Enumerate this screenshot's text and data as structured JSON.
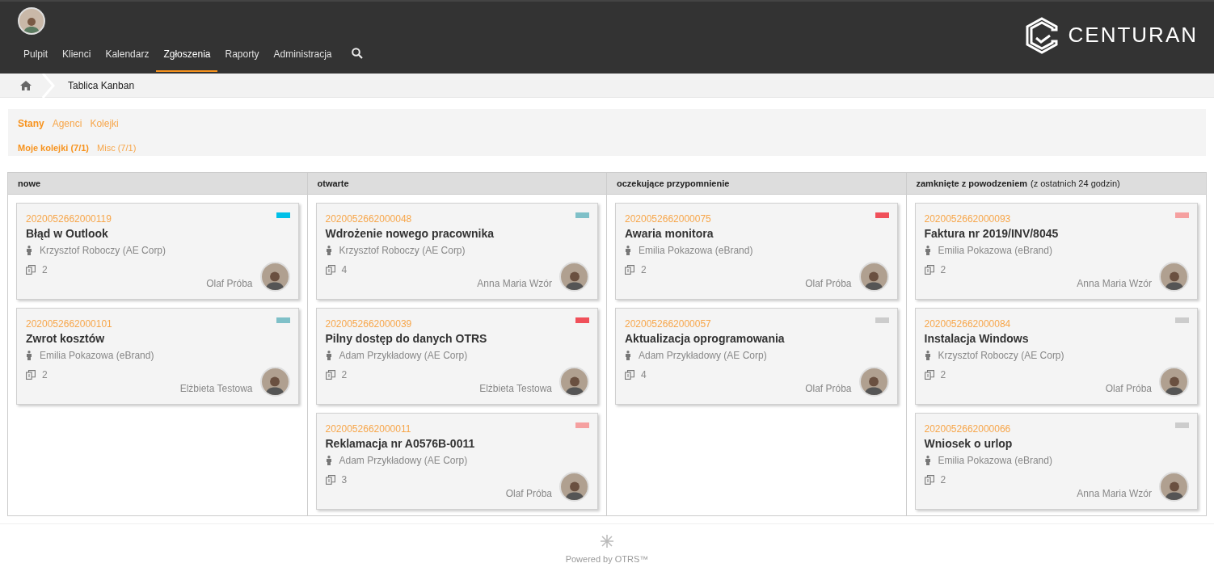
{
  "nav": [
    {
      "label": "Pulpit",
      "selected": false
    },
    {
      "label": "Klienci",
      "selected": false
    },
    {
      "label": "Kalendarz",
      "selected": false
    },
    {
      "label": "Zgłoszenia",
      "selected": true
    },
    {
      "label": "Raporty",
      "selected": false
    },
    {
      "label": "Administracja",
      "selected": false
    }
  ],
  "logo": {
    "text": "CENTURAN"
  },
  "breadcrumb": [
    "Tablica Kanban"
  ],
  "view_filters": [
    {
      "label": "Stany",
      "selected": true
    },
    {
      "label": "Agenci",
      "selected": false
    },
    {
      "label": "Kolejki",
      "selected": false
    }
  ],
  "queue_filters": [
    {
      "label": "Moje kolejki (7/1)",
      "selected": true
    },
    {
      "label": "Misc (7/1)",
      "selected": false
    }
  ],
  "columns": [
    {
      "title": "nowe",
      "cards": [
        {
          "number": "2020052662000119",
          "title": "Błąd w Outlook",
          "customer": "Krzysztof Roboczy (AE Corp)",
          "articles": "2",
          "owner": "Olaf Próba",
          "color": "#00c0e8"
        },
        {
          "number": "2020052662000101",
          "title": "Zwrot kosztów",
          "customer": "Emilia Pokazowa (eBrand)",
          "articles": "2",
          "owner": "Elżbieta Testowa",
          "color": "#7fc0c8"
        }
      ]
    },
    {
      "title": "otwarte",
      "cards": [
        {
          "number": "2020052662000048",
          "title": "Wdrożenie nowego pracownika",
          "customer": "Krzysztof Roboczy (AE Corp)",
          "articles": "4",
          "owner": "Anna Maria Wzór",
          "color": "#7fc0c8"
        },
        {
          "number": "2020052662000039",
          "title": "Pilny dostęp do danych OTRS",
          "customer": "Adam Przykładowy (AE Corp)",
          "articles": "2",
          "owner": "Elżbieta Testowa",
          "color": "#f0505a"
        },
        {
          "number": "2020052662000011",
          "title": "Reklamacja nr A0576B-0011",
          "customer": "Adam Przykładowy (AE Corp)",
          "articles": "3",
          "owner": "Olaf Próba",
          "color": "#f5a0a0"
        }
      ]
    },
    {
      "title": "oczekujące przypomnienie",
      "cards": [
        {
          "number": "2020052662000075",
          "title": "Awaria monitora",
          "customer": "Emilia Pokazowa (eBrand)",
          "articles": "2",
          "owner": "Olaf Próba",
          "color": "#f0505a"
        },
        {
          "number": "2020052662000057",
          "title": "Aktualizacja oprogramowania",
          "customer": "Adam Przykładowy (AE Corp)",
          "articles": "4",
          "owner": "Olaf Próba",
          "color": "#cccccc"
        }
      ]
    },
    {
      "title": "zamknięte z powodzeniem",
      "note": "(z ostatnich 24 godzin)",
      "cards": [
        {
          "number": "2020052662000093",
          "title": "Faktura nr 2019/INV/8045",
          "customer": "Emilia Pokazowa (eBrand)",
          "articles": "2",
          "owner": "Anna Maria Wzór",
          "color": "#f5a0a0"
        },
        {
          "number": "2020052662000084",
          "title": "Instalacja Windows",
          "customer": "Krzysztof Roboczy (AE Corp)",
          "articles": "2",
          "owner": "Olaf Próba",
          "color": "#cccccc"
        },
        {
          "number": "2020052662000066",
          "title": "Wniosek o urlop",
          "customer": "Emilia Pokazowa (eBrand)",
          "articles": "2",
          "owner": "Anna Maria Wzór",
          "color": "#cccccc"
        }
      ]
    }
  ],
  "footer": {
    "text": "Powered by OTRS™"
  }
}
